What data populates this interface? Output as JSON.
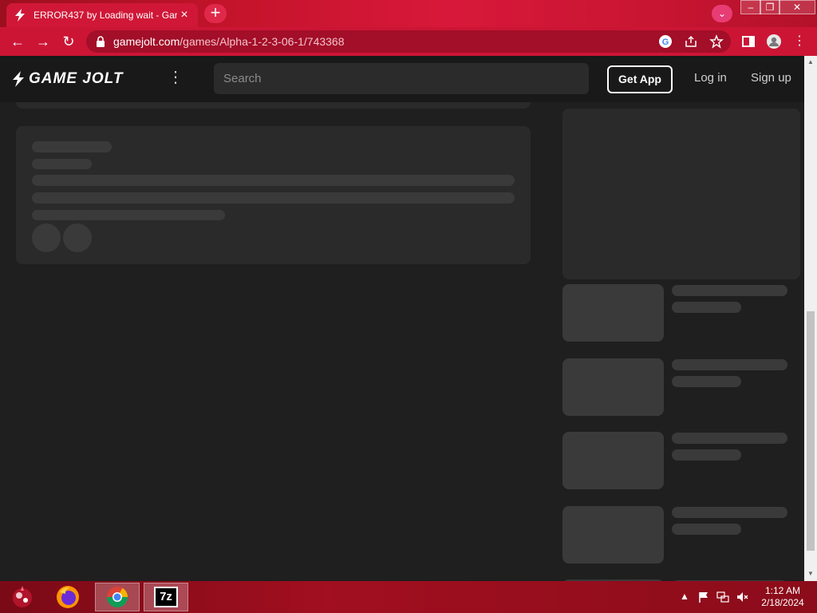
{
  "browser": {
    "tab_title": "ERROR437 by Loading wait - Gar",
    "tab_close": "×",
    "new_tab": "+",
    "url_host": "gamejolt.com",
    "url_path": "/games/Alpha-1-2-3-06-1/743368",
    "window_controls": {
      "minimize": "–",
      "maximize": "❐",
      "close": "✕"
    }
  },
  "gamejolt": {
    "logo_text": "GAME JOLT",
    "search_placeholder": "Search",
    "get_app_label": "Get App",
    "login_label": "Log in",
    "signup_label": "Sign up"
  },
  "taskbar": {
    "time": "1:12 AM",
    "date": "2/18/2024",
    "apps": [
      "start-orb",
      "firefox",
      "chrome",
      "7-zip"
    ],
    "sevenzip_label": "7z"
  },
  "colors": {
    "accent": "#cc1535",
    "page_bg": "#1f1f1f",
    "skeleton": "#3a3a3a",
    "card": "#2a2a2a"
  }
}
